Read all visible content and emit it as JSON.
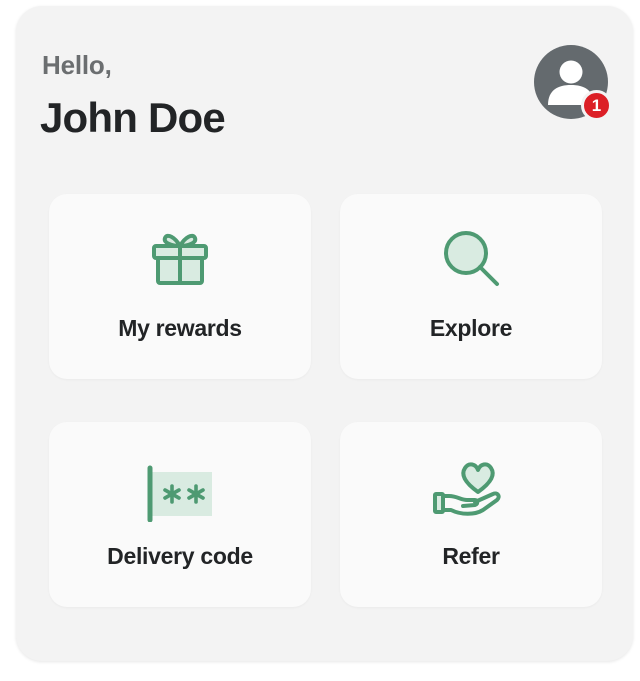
{
  "header": {
    "greeting": "Hello,",
    "user_name": "John Doe",
    "notification_count": "1"
  },
  "tiles": [
    {
      "label": "My rewards",
      "icon": "gift-icon"
    },
    {
      "label": "Explore",
      "icon": "search-icon"
    },
    {
      "label": "Delivery code",
      "icon": "password-code-icon"
    },
    {
      "label": "Refer",
      "icon": "heart-hand-icon"
    }
  ],
  "colors": {
    "accent": "#4e9a72",
    "accent_fill": "#d9ebe1",
    "card_background": "#f3f3f3",
    "tile_background": "#fafafa",
    "avatar": "#646a6e",
    "badge": "#dc1f26",
    "text_primary": "#222426",
    "text_secondary": "#6b6e70"
  }
}
